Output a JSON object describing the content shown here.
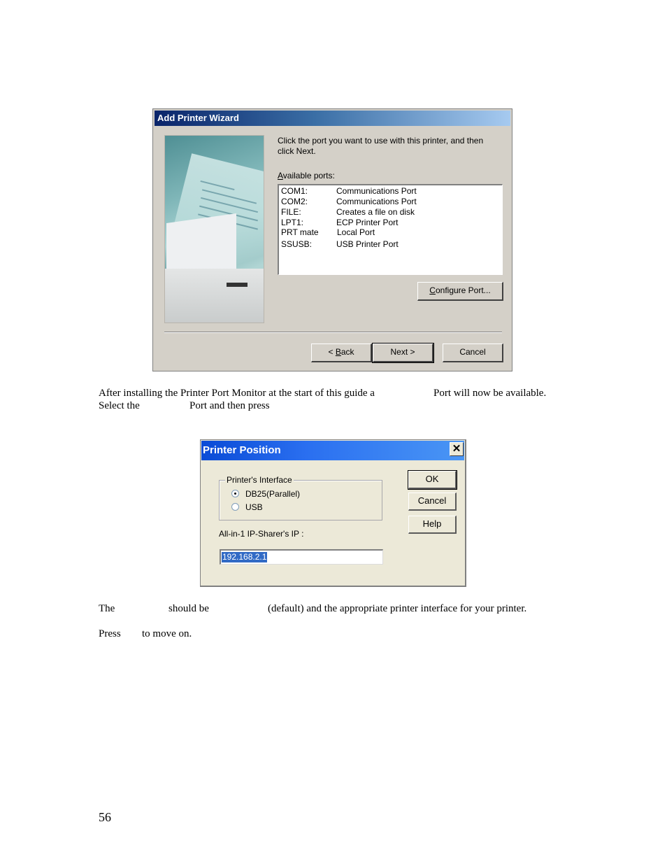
{
  "wizard": {
    "title": "Add Printer Wizard",
    "instruction": "Click the port you want to use with this printer, and then click Next.",
    "available_ports_label": "Available ports:",
    "available_ports_accel": "A",
    "available_ports_rest": "vailable ports:",
    "ports": [
      {
        "name": "COM1:",
        "description": "Communications Port"
      },
      {
        "name": "COM2:",
        "description": "Communications Port"
      },
      {
        "name": "FILE:",
        "description": "Creates a file on disk"
      },
      {
        "name": "LPT1:",
        "description": "ECP Printer Port"
      },
      {
        "name": "PRT mate",
        "description": "Local Port"
      },
      {
        "name": "SSUSB:",
        "description": "USB Printer Port"
      }
    ],
    "configure_accel": "C",
    "configure_rest": "onfigure Port...",
    "back_prefix": "< ",
    "back_accel": "B",
    "back_rest": "ack",
    "next_label": "Next >",
    "cancel_label": "Cancel"
  },
  "doc": {
    "para1_line1_a": "After installing the Printer Port Monitor at the start of this guide a",
    "para1_line1_b": "Port will now be available.",
    "para1_line2_a": "Select the",
    "para1_line2_b": "Port and then press",
    "para2_a": "The",
    "para2_b": "should be",
    "para2_c": "(default) and the appropriate printer interface for your printer.",
    "para3_a": "Press",
    "para3_b": "to move on.",
    "page_number": "56"
  },
  "printer_position": {
    "title": "Printer Position",
    "close_glyph": "✕",
    "group_label": "Printer's Interface",
    "options": [
      {
        "label": "DB25(Parallel)",
        "selected": true
      },
      {
        "label": "USB",
        "selected": false
      }
    ],
    "ip_label": "All-in-1 IP-Sharer's IP :",
    "ip_value": "192.168.2.1",
    "ok_label": "OK",
    "cancel_label": "Cancel",
    "help_label": "Help"
  }
}
